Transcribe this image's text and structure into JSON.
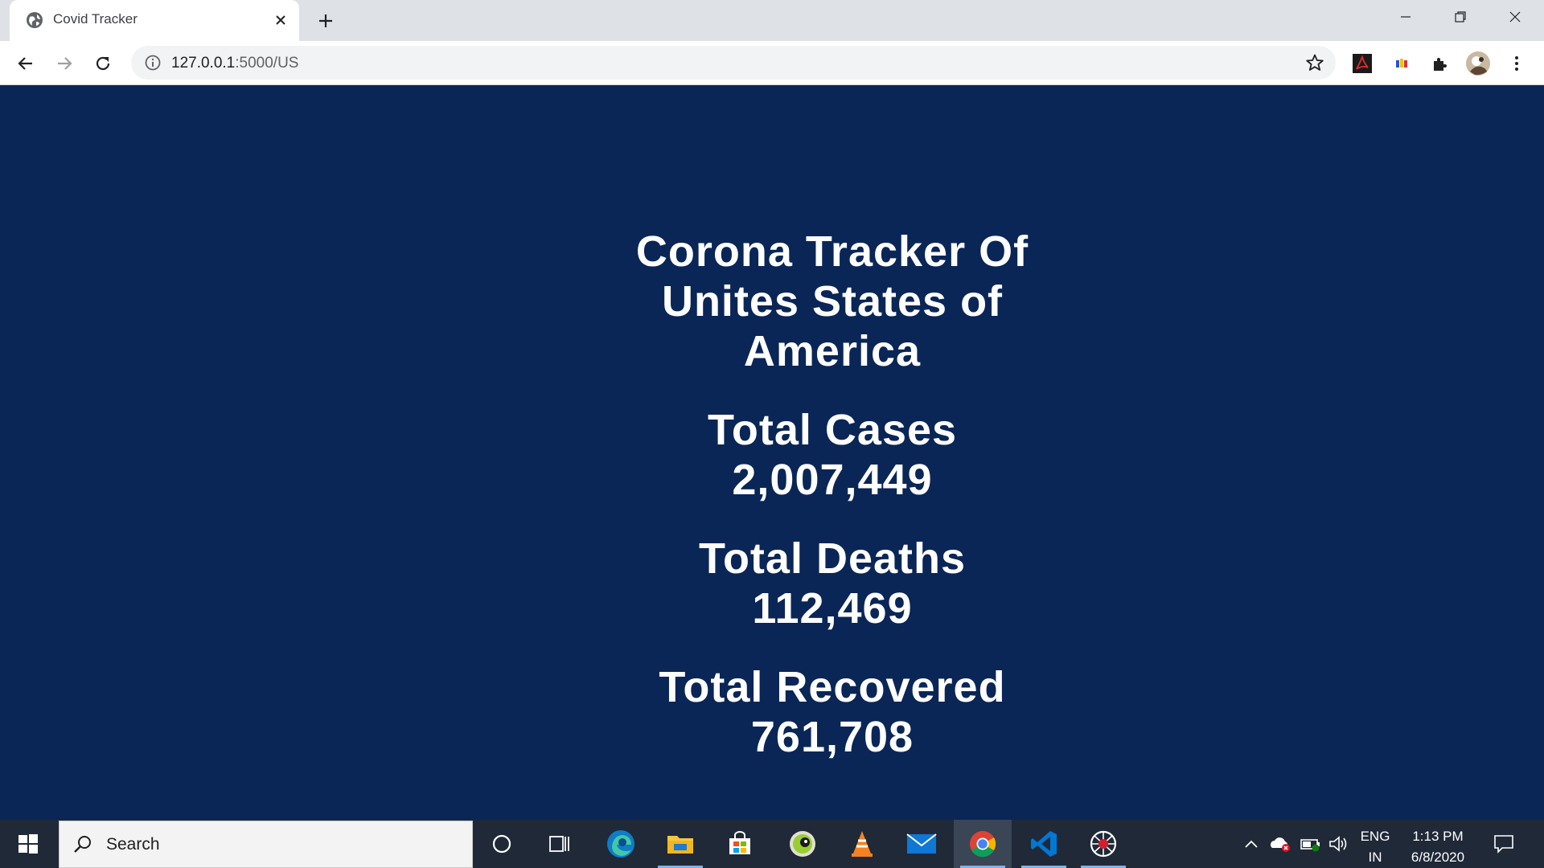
{
  "browser": {
    "tab": {
      "title": "Covid Tracker"
    },
    "address": {
      "host": "127.0.0.1",
      "path": ":5000/US"
    }
  },
  "page": {
    "title": "Corona Tracker Of Unites States of America",
    "stats": [
      {
        "label": "Total Cases",
        "value": "2,007,449"
      },
      {
        "label": "Total Deaths",
        "value": "112,469"
      },
      {
        "label": "Total Recovered",
        "value": "761,708"
      }
    ]
  },
  "taskbar": {
    "search_placeholder": "Search",
    "language": {
      "line1": "ENG",
      "line2": "IN"
    },
    "clock": {
      "time": "1:13 PM",
      "date": "6/8/2020"
    }
  },
  "colors": {
    "page_background": "#0a2657",
    "page_text": "#ffffff",
    "taskbar": "#202938"
  },
  "icons": [
    "globe-icon",
    "close-icon",
    "plus-icon",
    "minimize-icon",
    "restore-icon",
    "back-icon",
    "forward-icon",
    "reload-icon",
    "info-icon",
    "star-icon",
    "pdf-extension-icon",
    "color-extension-icon",
    "puzzle-icon",
    "profile-avatar",
    "menu-icon",
    "windows-logo-icon",
    "search-icon",
    "cortana-icon",
    "task-view-icon",
    "edge-icon",
    "file-explorer-icon",
    "store-icon",
    "app-icon",
    "vlc-icon",
    "mail-icon",
    "chrome-icon",
    "vscode-icon",
    "web-icon",
    "chevron-up-icon",
    "onedrive-icon",
    "battery-icon",
    "volume-icon",
    "notifications-icon"
  ]
}
